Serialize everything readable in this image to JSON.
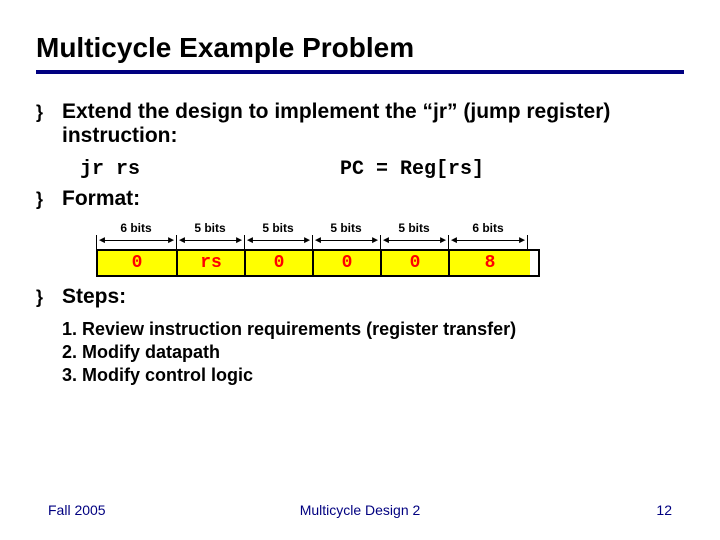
{
  "title": "Multicycle Example Problem",
  "bullet1": "Extend the design to implement the “jr” (jump register) instruction:",
  "code": {
    "instr": "jr rs",
    "effect": "PC = Reg[rs]"
  },
  "bullet2": "Format:",
  "format": {
    "labels": [
      "6 bits",
      "5 bits",
      "5 bits",
      "5 bits",
      "5 bits",
      "6 bits"
    ],
    "fields": [
      "0",
      "rs",
      "0",
      "0",
      "0",
      "8"
    ]
  },
  "bullet3": "Steps:",
  "steps": [
    "1. Review instruction requirements (register transfer)",
    "2. Modify datapath",
    "3. Modify control logic"
  ],
  "footer": {
    "left": "Fall 2005",
    "center": "Multicycle Design 2",
    "right": "12"
  }
}
